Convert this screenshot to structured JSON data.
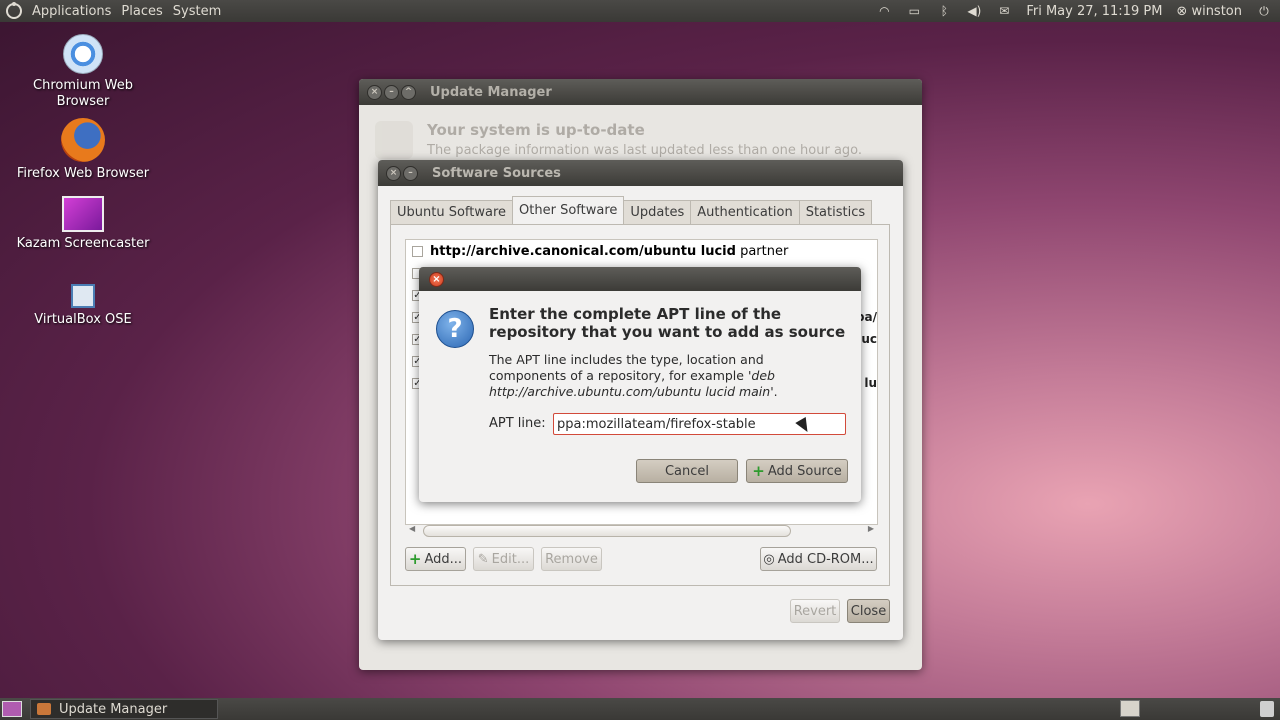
{
  "top_panel": {
    "menus": [
      "Applications",
      "Places",
      "System"
    ],
    "clock": "Fri May 27, 11:19 PM",
    "user": "winston"
  },
  "desktop": {
    "icons": [
      {
        "label": "Chromium Web Browser",
        "icon": "chromium-icon"
      },
      {
        "label": "Firefox Web Browser",
        "icon": "firefox-icon"
      },
      {
        "label": "Kazam Screencaster",
        "icon": "kazam-icon"
      },
      {
        "label": "VirtualBox OSE",
        "icon": "virtualbox-icon"
      }
    ]
  },
  "update_manager": {
    "title": "Update Manager",
    "status_title": "Your system is up-to-date",
    "status_sub": "The package information was last updated less than one hour ago."
  },
  "software_sources": {
    "title": "Software Sources",
    "tabs": [
      "Ubuntu Software",
      "Other Software",
      "Updates",
      "Authentication",
      "Statistics"
    ],
    "active_tab": "Other Software",
    "sources": [
      {
        "url": "http://archive.canonical.com/ubuntu lucid",
        "component": "partner",
        "checked": false
      },
      {
        "url": "",
        "component": "",
        "checked": false
      },
      {
        "url": "",
        "component": "",
        "checked": true,
        "fragment": ""
      },
      {
        "url": "",
        "component": "",
        "checked": true,
        "fragment": "pa/"
      },
      {
        "url": "",
        "component": "",
        "checked": true,
        "fragment": "uc"
      },
      {
        "url": "",
        "component": "",
        "checked": true,
        "fragment": ""
      },
      {
        "url": "",
        "component": "",
        "checked": true,
        "fragment": "lu"
      }
    ],
    "buttons": {
      "add": "Add...",
      "edit": "Edit...",
      "remove": "Remove",
      "add_cdrom": "Add CD-ROM...",
      "revert": "Revert",
      "close": "Close"
    }
  },
  "apt_dialog": {
    "heading": "Enter the complete APT line of the repository that you want to add as source",
    "body_prefix": "The APT line includes the type, location and components of a repository, for example  '",
    "body_example": "deb http://archive.ubuntu.com/ubuntu lucid main",
    "body_suffix": "'.",
    "label": "APT line:",
    "value": "ppa:mozillateam/firefox-stable",
    "cancel": "Cancel",
    "add_source": "Add Source"
  },
  "taskbar": {
    "window_label": "Update Manager"
  }
}
